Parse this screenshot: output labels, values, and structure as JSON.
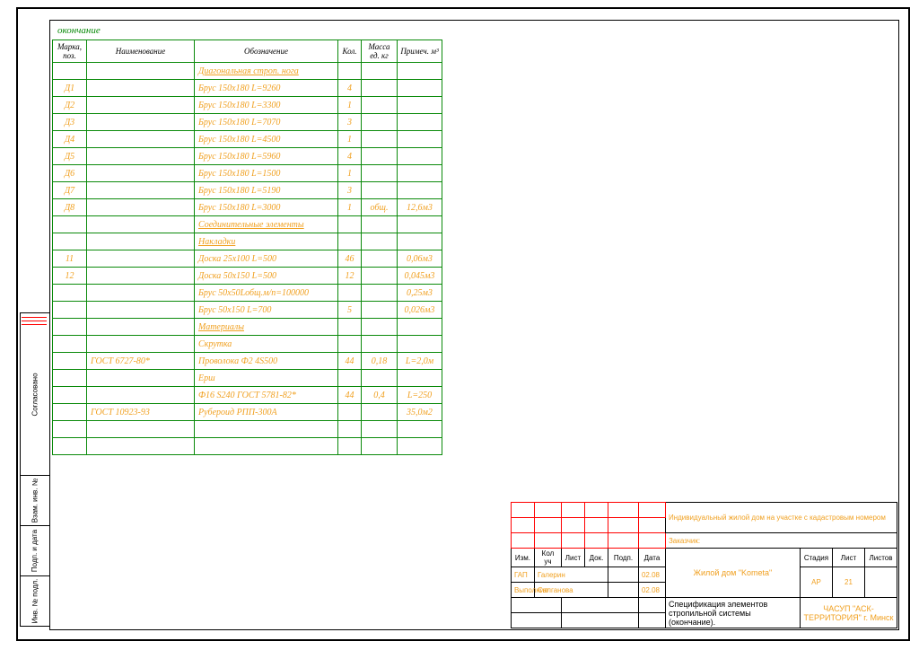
{
  "continuation": "окончание",
  "headers": {
    "mark": "Марка, поз.",
    "name": "Наименование",
    "design": "Обозначение",
    "qty": "Кол.",
    "mass": "Масса ед. кг",
    "note": "Примеч. м³"
  },
  "rows": [
    {
      "mark": "",
      "name": "",
      "design": "Диагональная строп. нога",
      "qty": "",
      "mass": "",
      "note": "",
      "u": true
    },
    {
      "mark": "Д1",
      "name": "",
      "design": "Брус 150х180      L=9260",
      "qty": "4",
      "mass": "",
      "note": ""
    },
    {
      "mark": "Д2",
      "name": "",
      "design": "Брус 150х180      L=3300",
      "qty": "1",
      "mass": "",
      "note": ""
    },
    {
      "mark": "Д3",
      "name": "",
      "design": "Брус 150х180      L=7070",
      "qty": "3",
      "mass": "",
      "note": ""
    },
    {
      "mark": "Д4",
      "name": "",
      "design": "Брус 150х180      L=4500",
      "qty": "1",
      "mass": "",
      "note": ""
    },
    {
      "mark": "Д5",
      "name": "",
      "design": "Брус 150х180      L=5960",
      "qty": "4",
      "mass": "",
      "note": ""
    },
    {
      "mark": "Д6",
      "name": "",
      "design": "Брус 150х180      L=1500",
      "qty": "1",
      "mass": "",
      "note": ""
    },
    {
      "mark": "Д7",
      "name": "",
      "design": "Брус 150х180      L=5190",
      "qty": "3",
      "mass": "",
      "note": ""
    },
    {
      "mark": "Д8",
      "name": "",
      "design": "Брус 150х180      L=3000",
      "qty": "1",
      "mass": "общ.",
      "note": "12,6м3"
    },
    {
      "mark": "",
      "name": "",
      "design": "Соединительные элементы",
      "qty": "",
      "mass": "",
      "note": "",
      "u": true
    },
    {
      "mark": "",
      "name": "",
      "design": "Накладки",
      "qty": "",
      "mass": "",
      "note": "",
      "u": true
    },
    {
      "mark": "11",
      "name": "",
      "design": "Доска 25х100      L=500",
      "qty": "46",
      "mass": "",
      "note": "0,06м3"
    },
    {
      "mark": "12",
      "name": "",
      "design": "Доска 50х150      L=500",
      "qty": "12",
      "mass": "",
      "note": "0,045м3"
    },
    {
      "mark": "",
      "name": "",
      "design": "Брус 50х50Lобщ.м/п=100000",
      "qty": "",
      "mass": "",
      "note": "0,25м3"
    },
    {
      "mark": "",
      "name": "",
      "design": "Брус 50х150      L=700",
      "qty": "5",
      "mass": "",
      "note": "0,026м3"
    },
    {
      "mark": "",
      "name": "",
      "design": "Материалы",
      "qty": "",
      "mass": "",
      "note": "",
      "u": true
    },
    {
      "mark": "",
      "name": "",
      "design": "Скрутка",
      "qty": "",
      "mass": "",
      "note": ""
    },
    {
      "mark": "",
      "name": "ГОСТ 6727-80*",
      "design": "Проволока Ф2 4S500",
      "qty": "44",
      "mass": "0,18",
      "note": "L=2,0м"
    },
    {
      "mark": "",
      "name": "",
      "design": "Ерш",
      "qty": "",
      "mass": "",
      "note": ""
    },
    {
      "mark": "",
      "name": "",
      "design": "Ф16 S240 ГОСТ 5781-82*",
      "qty": "44",
      "mass": "0,4",
      "note": "L=250"
    },
    {
      "mark": "",
      "name": "ГОСТ 10923-93",
      "design": "Рубероид РПП-300А",
      "qty": "",
      "mass": "",
      "note": "35,0м2"
    },
    {
      "mark": "",
      "name": "",
      "design": "",
      "qty": "",
      "mass": "",
      "note": ""
    },
    {
      "mark": "",
      "name": "",
      "design": "",
      "qty": "",
      "mass": "",
      "note": ""
    }
  ],
  "side": [
    "Согласовано",
    "Взам. инв. №",
    "Подп. и дата",
    "Инв. № подл."
  ],
  "tb": {
    "proj_line": "Индивидуальный жилой дом на участке с кадастровым номером",
    "client": "Заказчик:",
    "hdr": [
      "Изм.",
      "Кол уч",
      "Лист",
      "Док.",
      "Подп.",
      "Дата"
    ],
    "object": "Жилой дом \"Kometa\"",
    "roles": [
      [
        "ГАП",
        "Галерин",
        "",
        "02.08"
      ],
      [
        "Выполнил",
        "Салганова",
        "",
        "02.08"
      ]
    ],
    "desc": "Спецификация элементов стропильной системы (окончание).",
    "company": "ЧАСУП \"АСК-ТЕРРИТОРИЯ\" г. Минск",
    "sll": [
      "Стадия",
      "Лист",
      "Листов"
    ],
    "stage": "АР",
    "sheet": "21",
    "sheets": ""
  }
}
